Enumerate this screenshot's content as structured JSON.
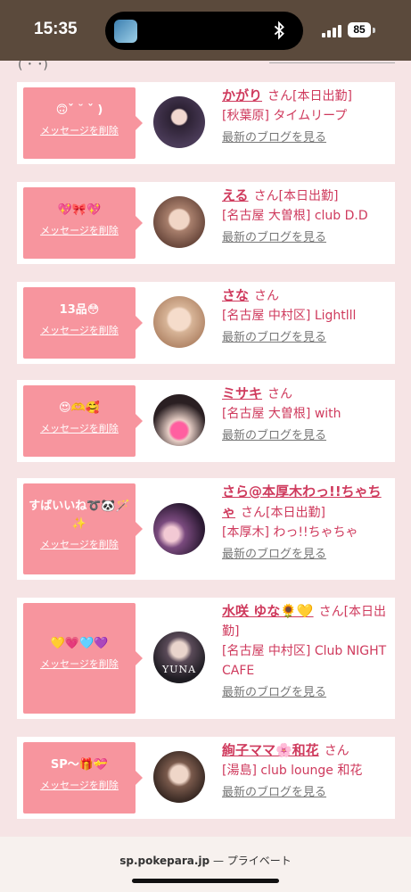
{
  "status": {
    "time": "15:35",
    "battery": "85"
  },
  "list_header": {
    "text": "( ･ ･)"
  },
  "delete_label": "メッセージを削除",
  "blog_label": "最新のブログを見る",
  "cards": [
    {
      "message": "🙃ˇ ˘ ˇ )",
      "name": "かがり",
      "san": "さん[本日出勤]",
      "shop": "[秋葉原] タイムリープ",
      "avatar_color": "#3a2f44"
    },
    {
      "message": "💖🎀💖",
      "name": "える",
      "san": "さん[本日出勤]",
      "shop": "[名古屋 大曽根] club D.D",
      "avatar_color": "#c89a88"
    },
    {
      "message": "13品😳",
      "name": "さな",
      "san": "さん",
      "shop": "[名古屋 中村区] Lightlll",
      "avatar_color": "#e3c4ad"
    },
    {
      "message": "😍🫶🥰",
      "name": "ミサキ",
      "san": "さん",
      "shop": "[名古屋 大曽根] with",
      "avatar_color": "#3b2b2d"
    },
    {
      "message": "すばいいね➰🐼🪄✨",
      "name": "さら@本厚木わっ!!ちゃちゃ",
      "san": "さん[本日出勤]",
      "shop": "[本厚木] わっ!!ちゃちゃ",
      "avatar_color": "#4a2c4c"
    },
    {
      "message": "💛💗🩵💜",
      "name": "水咲 ゆな🌻💛",
      "san": "さん[本日出勤]",
      "shop": "[名古屋 中村区] Club NIGHT CAFE",
      "avatar_color": "#2c2a30",
      "avatar_text": "YUNA"
    },
    {
      "message": "SP〜🎁💝",
      "name": "絢子ママ🌸和花",
      "san": "さん",
      "shop": "[湯島] club lounge 和花",
      "avatar_color": "#4c3a33"
    }
  ],
  "browser": {
    "domain": "sp.pokepara.jp",
    "privacy": "— プライベート"
  }
}
